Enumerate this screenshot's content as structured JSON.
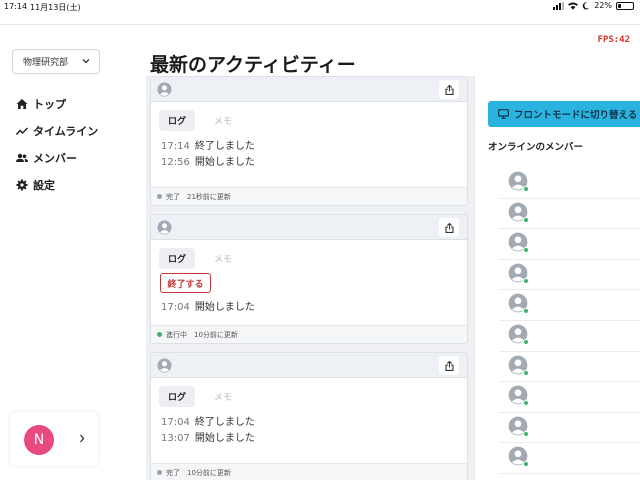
{
  "status_bar": {
    "time": "17:14",
    "date": "11月13日(土)",
    "battery": "22%",
    "battery_level": 0.22
  },
  "fps": "FPS:42",
  "sidebar": {
    "workspace": "物理研究部",
    "nav": [
      {
        "label": "トップ",
        "icon": "home-icon"
      },
      {
        "label": "タイムライン",
        "icon": "trend-icon"
      },
      {
        "label": "メンバー",
        "icon": "users-icon"
      },
      {
        "label": "設定",
        "icon": "gear-icon"
      }
    ],
    "user_initial": "N"
  },
  "main": {
    "title": "最新のアクティビティー",
    "cards": [
      {
        "tab_log": "ログ",
        "tab_memo": "メモ",
        "entries": [
          {
            "time": "17:14",
            "text": "終了しました"
          },
          {
            "time": "12:56",
            "text": "開始しました"
          }
        ],
        "status": "完了",
        "updated": "21秒前に更新"
      },
      {
        "tab_log": "ログ",
        "tab_memo": "メモ",
        "end_button": "終了する",
        "entries": [
          {
            "time": "17:04",
            "text": "開始しました"
          }
        ],
        "status": "進行中",
        "updated": "10分前に更新"
      },
      {
        "tab_log": "ログ",
        "tab_memo": "メモ",
        "entries": [
          {
            "time": "17:04",
            "text": "終了しました"
          },
          {
            "time": "13:07",
            "text": "開始しました"
          }
        ],
        "status": "完了",
        "updated": "10分前に更新"
      }
    ]
  },
  "right_panel": {
    "mode_button": "フロントモードに切り替える",
    "online_title": "オンラインのメンバー",
    "member_count": 10
  },
  "colors": {
    "accent": "#2bb3e0",
    "danger": "#c43a3a",
    "online": "#3db36b",
    "avatar": "#e84a7f",
    "status_done": "#9aa3ad",
    "status_active": "#3db36b"
  }
}
